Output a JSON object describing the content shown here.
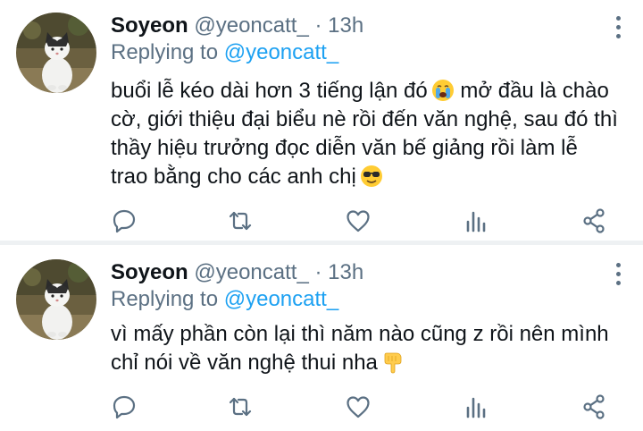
{
  "tweets": [
    {
      "author": {
        "name": "Soyeon",
        "handle": "@yeoncatt_"
      },
      "separator": "·",
      "time": "13h",
      "replying_prefix": "Replying to",
      "replying_to": "@yeoncatt_",
      "text": "buổi lễ kéo dài hơn 3 tiếng lận đó",
      "text_after_emoji": " mở đầu là chào cờ, giới thiệu đại biểu nè rồi đến văn nghệ, sau đó thì thầy hiệu trưởng đọc diễn văn bế giảng rồi làm lễ trao bằng cho các anh chị",
      "emojis": [
        "crying-face-emoji",
        "sunglasses-face-emoji"
      ]
    },
    {
      "author": {
        "name": "Soyeon",
        "handle": "@yeoncatt_"
      },
      "separator": "·",
      "time": "13h",
      "replying_prefix": "Replying to",
      "replying_to": "@yeoncatt_",
      "text": "vì mấy phần còn lại thì năm nào cũng z rồi nên mình chỉ nói về văn nghệ thui nha",
      "emojis": [
        "backhand-pointing-down-emoji"
      ]
    }
  ],
  "icons": [
    "reply-icon",
    "retweet-icon",
    "like-icon",
    "analytics-icon",
    "share-icon",
    "more-icon"
  ],
  "colors": {
    "secondary_text": "#5b7083",
    "link": "#1da1f2",
    "divider": "#eef1f3"
  }
}
